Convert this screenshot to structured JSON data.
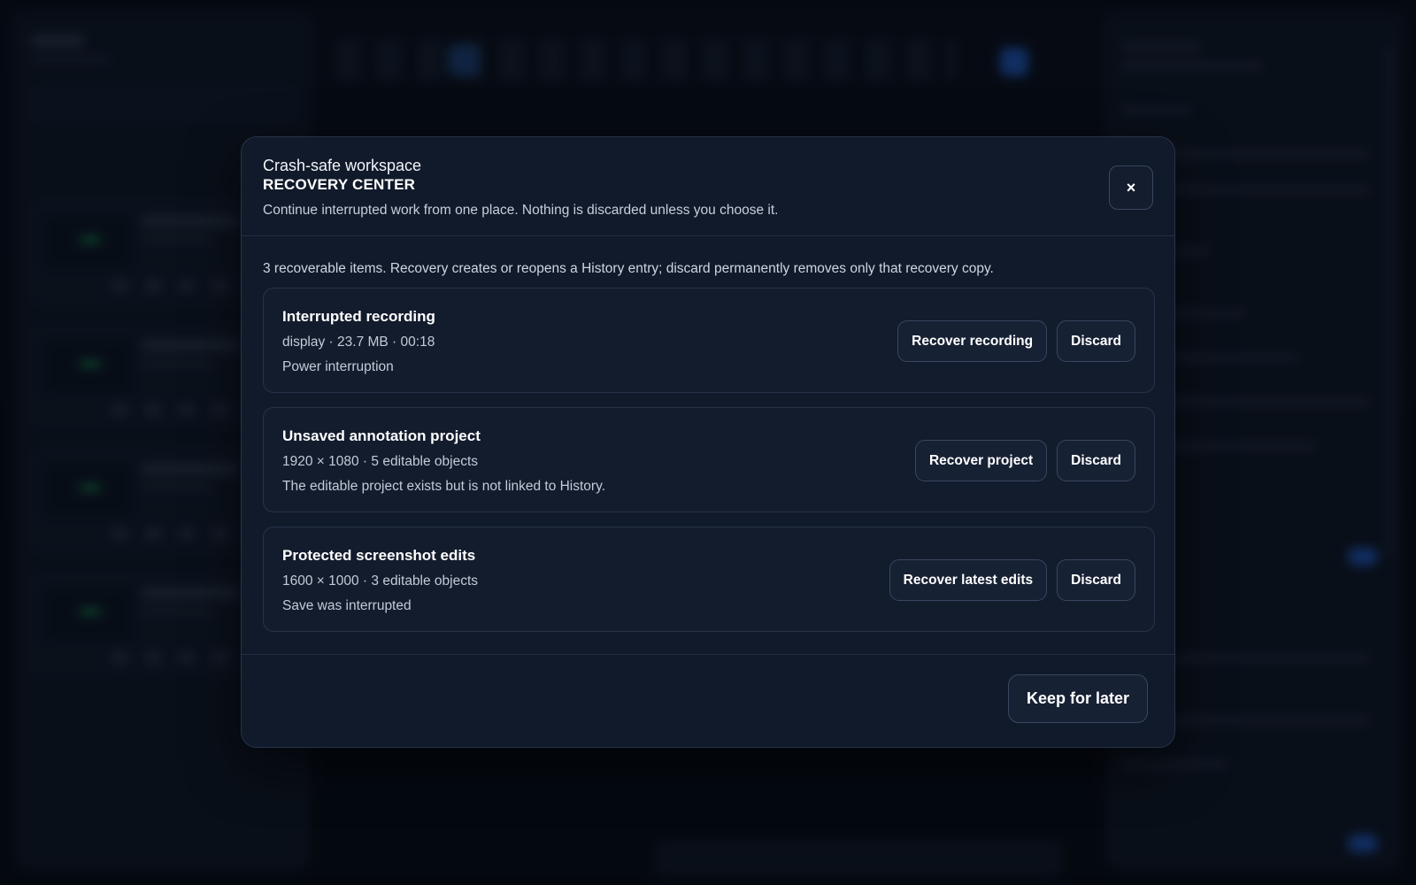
{
  "dialog": {
    "eyebrow": "Crash-safe workspace",
    "title": "RECOVERY CENTER",
    "subtitle": "Continue interrupted work from one place. Nothing is discarded unless you choose it.",
    "close_label": "×",
    "close_icon": "close-icon",
    "summary": "3 recoverable items. Recovery creates or reopens a History entry; discard permanently removes only that recovery copy.",
    "items": [
      {
        "name": "Interrupted recording",
        "meta": "display · 23.7 MB · 00:18",
        "note": "Power interruption",
        "recover_label": "Recover recording",
        "discard_label": "Discard"
      },
      {
        "name": "Unsaved annotation project",
        "meta": "1920 × 1080 · 5 editable objects",
        "note": "The editable project exists but is not linked to History.",
        "recover_label": "Recover project",
        "discard_label": "Discard"
      },
      {
        "name": "Protected screenshot edits",
        "meta": "1600 × 1000 · 3 editable objects",
        "note": "Save was interrupted",
        "recover_label": "Recover latest edits",
        "discard_label": "Discard"
      }
    ],
    "footer": {
      "keep_label": "Keep for later"
    }
  },
  "colors": {
    "modal_bg": "#111a2a",
    "border": "#27324a",
    "text_primary": "#ffffff",
    "text_secondary": "#c3cbd8",
    "accent": "#1d4fa8"
  }
}
